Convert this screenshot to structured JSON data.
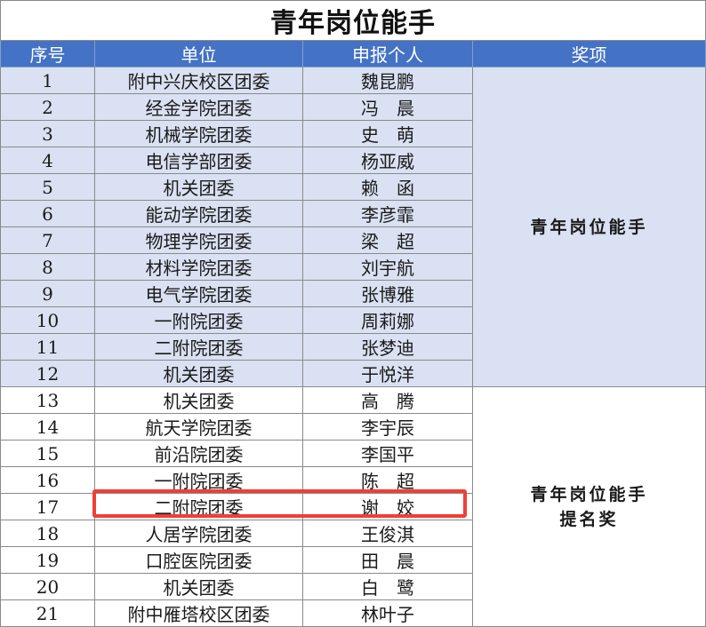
{
  "title": "青年岗位能手",
  "headers": {
    "no": "序号",
    "unit": "单位",
    "applicant": "申报个人",
    "award": "奖项"
  },
  "rows": [
    {
      "no": "1",
      "unit": "附中兴庆校区团委",
      "applicant": "魏昆鹏"
    },
    {
      "no": "2",
      "unit": "经金学院团委",
      "applicant": "冯　晨"
    },
    {
      "no": "3",
      "unit": "机械学院团委",
      "applicant": "史　萌"
    },
    {
      "no": "4",
      "unit": "电信学部团委",
      "applicant": "杨亚威"
    },
    {
      "no": "5",
      "unit": "机关团委",
      "applicant": "赖　函"
    },
    {
      "no": "6",
      "unit": "能动学院团委",
      "applicant": "李彦霏"
    },
    {
      "no": "7",
      "unit": "物理学院团委",
      "applicant": "梁　超"
    },
    {
      "no": "8",
      "unit": "材料学院团委",
      "applicant": "刘宇航"
    },
    {
      "no": "9",
      "unit": "电气学院团委",
      "applicant": "张博雅"
    },
    {
      "no": "10",
      "unit": "一附院团委",
      "applicant": "周莉娜"
    },
    {
      "no": "11",
      "unit": "二附院团委",
      "applicant": "张梦迪"
    },
    {
      "no": "12",
      "unit": "机关团委",
      "applicant": "于悦洋"
    },
    {
      "no": "13",
      "unit": "机关团委",
      "applicant": "高　腾"
    },
    {
      "no": "14",
      "unit": "航天学院团委",
      "applicant": "李宇辰"
    },
    {
      "no": "15",
      "unit": "前沿院团委",
      "applicant": "李国平"
    },
    {
      "no": "16",
      "unit": "一附院团委",
      "applicant": "陈　超"
    },
    {
      "no": "17",
      "unit": "二附院团委",
      "applicant": "谢　姣"
    },
    {
      "no": "18",
      "unit": "人居学院团委",
      "applicant": "王俊淇"
    },
    {
      "no": "19",
      "unit": "口腔医院团委",
      "applicant": "田　晨"
    },
    {
      "no": "20",
      "unit": "机关团委",
      "applicant": "白　鹭"
    },
    {
      "no": "21",
      "unit": "附中雁塔校区团委",
      "applicant": "林叶子"
    }
  ],
  "awards": {
    "group1": "青年岗位能手",
    "group2_line1": "青年岗位能手",
    "group2_line2": "提名奖"
  },
  "highlight_color": "#ef3f37",
  "header_color": "#4472c4",
  "band_color": "#d9e1f2"
}
